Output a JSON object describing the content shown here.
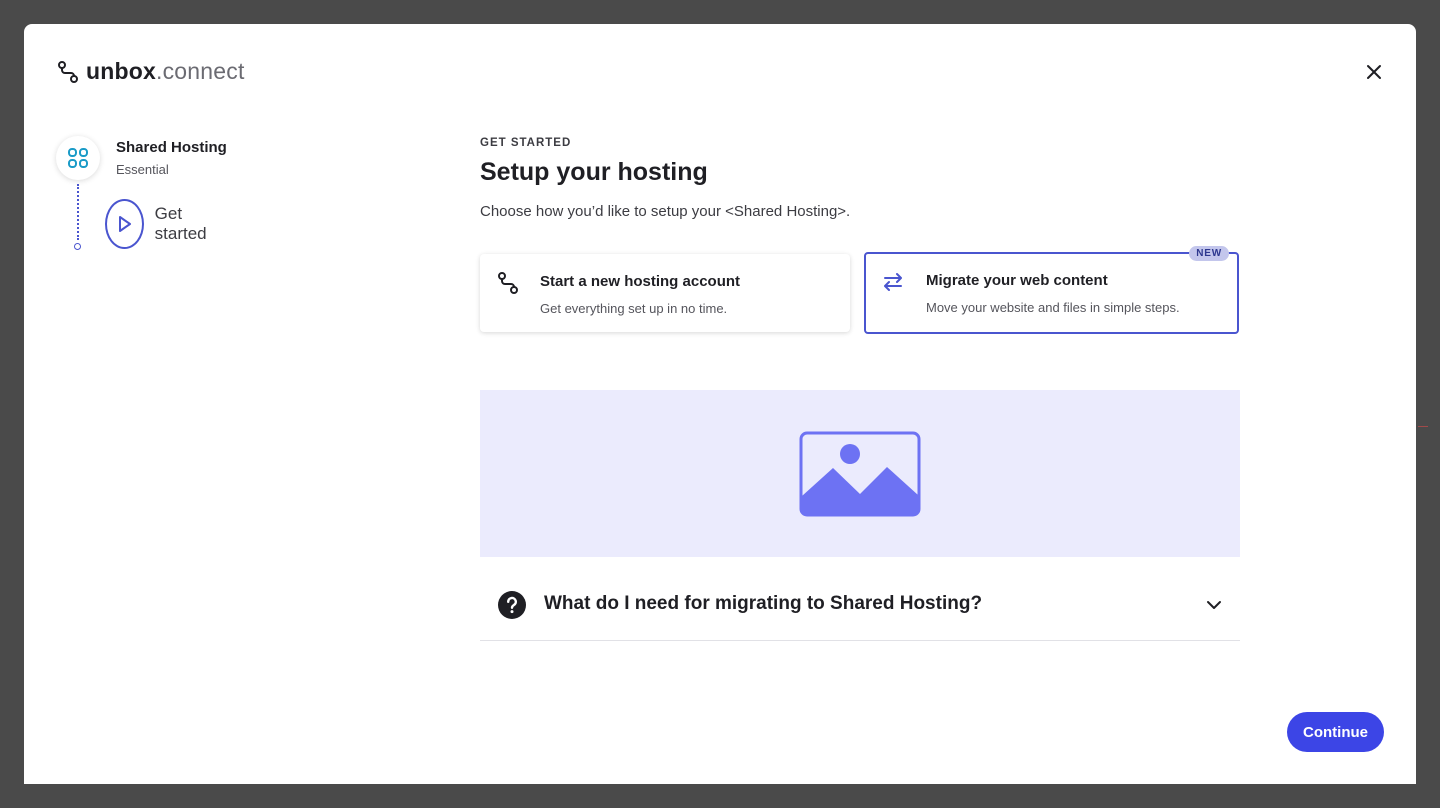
{
  "colors": {
    "accent": "#4a55cf",
    "button": "#3c45e6",
    "media_bg": "#ebebfd",
    "media_icon": "#6d72f3",
    "backdrop": "#4a4a4a"
  },
  "header": {
    "logo_brand": "unbox",
    "logo_tld": ".connect",
    "logo_icon": "route-icon",
    "close_icon": "close-icon"
  },
  "stepper": {
    "product": {
      "title": "Shared Hosting",
      "subtitle": "Essential",
      "icon": "apps-icon"
    },
    "current_step": {
      "label": "Get started",
      "icon": "play-icon"
    }
  },
  "main": {
    "eyebrow": "GET STARTED",
    "title": "Setup your hosting",
    "subtitle": "Choose how you’d like to setup your <Shared Hosting>.",
    "options": [
      {
        "title": "Start a new hosting account",
        "description": "Get everything set up in no time.",
        "icon": "route-icon",
        "selected": false
      },
      {
        "title": "Migrate your web content",
        "description": "Move your website and files in simple steps.",
        "icon": "swap-arrows-icon",
        "badge": "NEW",
        "selected": true
      }
    ],
    "media_icon": "image-placeholder-icon",
    "faq": {
      "question": "What do I need for migrating to Shared Hosting?",
      "icon": "question-circle-icon",
      "expanded": false
    }
  },
  "footer": {
    "continue_label": "Continue"
  }
}
